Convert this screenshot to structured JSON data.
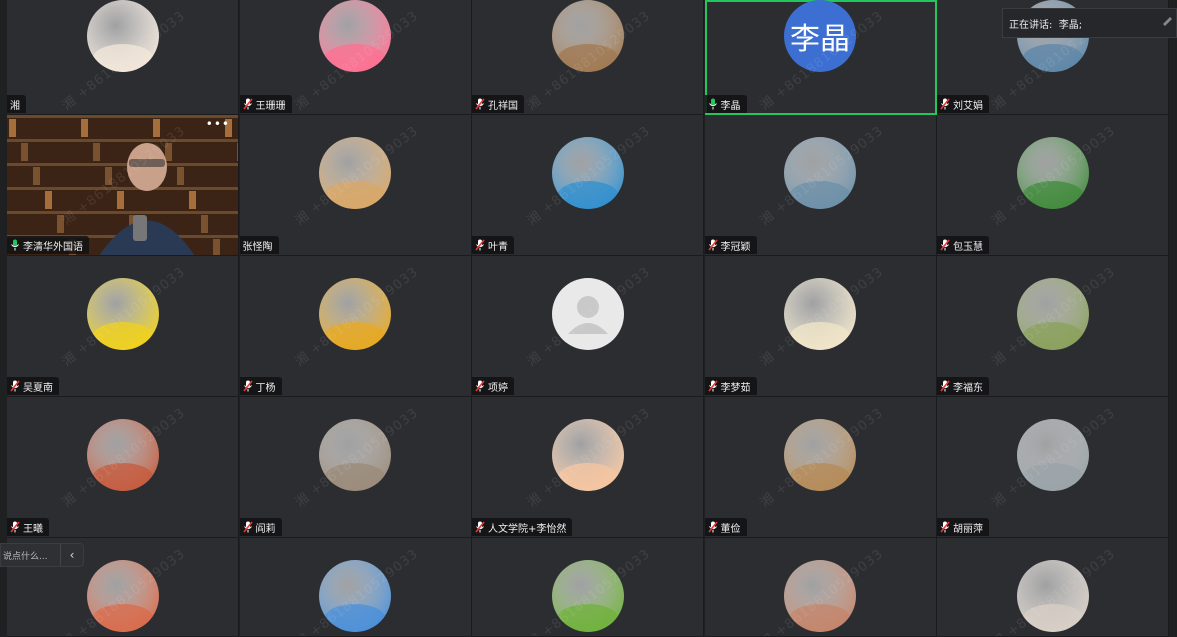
{
  "watermark_text": "湘 +8618810529033",
  "speaking_bar": {
    "label": "正在讲话:",
    "speaker": "李晶;"
  },
  "chat_input": {
    "placeholder": "说点什么...",
    "collapse_glyph": "‹"
  },
  "participants": [
    {
      "name": "湘",
      "mic": "none",
      "avatar": "cartoon-girl-hood",
      "color": "#f3e7da",
      "active": false
    },
    {
      "name": "王珊珊",
      "mic": "muted",
      "avatar": "cartoon-pink-bow",
      "color": "#ff6f91",
      "active": false
    },
    {
      "name": "孔祥国",
      "mic": "muted",
      "avatar": "colosseum-photo",
      "color": "#a07850",
      "active": false
    },
    {
      "name": "李晶",
      "mic": "on",
      "avatar": "letter",
      "letter": "李晶",
      "color": "#3c6fd1",
      "active": true
    },
    {
      "name": "刘艾娟",
      "mic": "muted",
      "avatar": "lake-photo",
      "color": "#5d86a8",
      "active": false
    },
    {
      "name": "李清华外国语",
      "mic": "on",
      "avatar": "video",
      "color": "#5a3a22",
      "active": false
    },
    {
      "name": "张怪陶",
      "mic": "none",
      "avatar": "festival-photo",
      "color": "#d9a766",
      "active": false
    },
    {
      "name": "叶青",
      "mic": "muted",
      "avatar": "kiki-cartoon",
      "color": "#2f8fcf",
      "active": false
    },
    {
      "name": "李冠颖",
      "mic": "muted",
      "avatar": "mascot-photo",
      "color": "#6b8fa8",
      "active": false
    },
    {
      "name": "包玉慧",
      "mic": "muted",
      "avatar": "tulips-photo",
      "color": "#3f8a3a",
      "active": false
    },
    {
      "name": "吴夏南",
      "mic": "muted",
      "avatar": "ladybug-photo",
      "color": "#f0d21a",
      "active": false
    },
    {
      "name": "丁杨",
      "mic": "muted",
      "avatar": "sunflower-photo",
      "color": "#e8a81e",
      "active": false
    },
    {
      "name": "项婷",
      "mic": "muted",
      "avatar": "default-user",
      "color": "#e6e6e6",
      "active": false
    },
    {
      "name": "李梦茹",
      "mic": "muted",
      "avatar": "bear-cartoon",
      "color": "#f2e6c8",
      "active": false
    },
    {
      "name": "李福东",
      "mic": "muted",
      "avatar": "valley-photo",
      "color": "#8aa05a",
      "active": false
    },
    {
      "name": "王曦",
      "mic": "muted",
      "avatar": "painting-photo",
      "color": "#c65a3c",
      "active": false
    },
    {
      "name": "阎莉",
      "mic": "muted",
      "avatar": "woman-mask-photo",
      "color": "#9a8a78",
      "active": false
    },
    {
      "name": "人文学院+李怡然",
      "mic": "muted",
      "avatar": "star-girl-cartoon",
      "color": "#f7c6a0",
      "active": false
    },
    {
      "name": "董俭",
      "mic": "muted",
      "avatar": "corgi-photo",
      "color": "#b58a56",
      "active": false
    },
    {
      "name": "胡丽萍",
      "mic": "muted",
      "avatar": "plants-photo",
      "color": "#9aa3a8",
      "active": false
    },
    {
      "name": "",
      "mic": "none",
      "avatar": "woman-photo",
      "color": "#d96a4a",
      "active": false
    },
    {
      "name": "",
      "mic": "none",
      "avatar": "glasses-girl-cartoon",
      "color": "#4a8fd9",
      "active": false
    },
    {
      "name": "",
      "mic": "none",
      "avatar": "leaves-photo",
      "color": "#6fb23a",
      "active": false
    },
    {
      "name": "",
      "mic": "none",
      "avatar": "child-photo",
      "color": "#c4846a",
      "active": false
    },
    {
      "name": "",
      "mic": "none",
      "avatar": "baby-photo",
      "color": "#d8cfc6",
      "active": false
    }
  ]
}
